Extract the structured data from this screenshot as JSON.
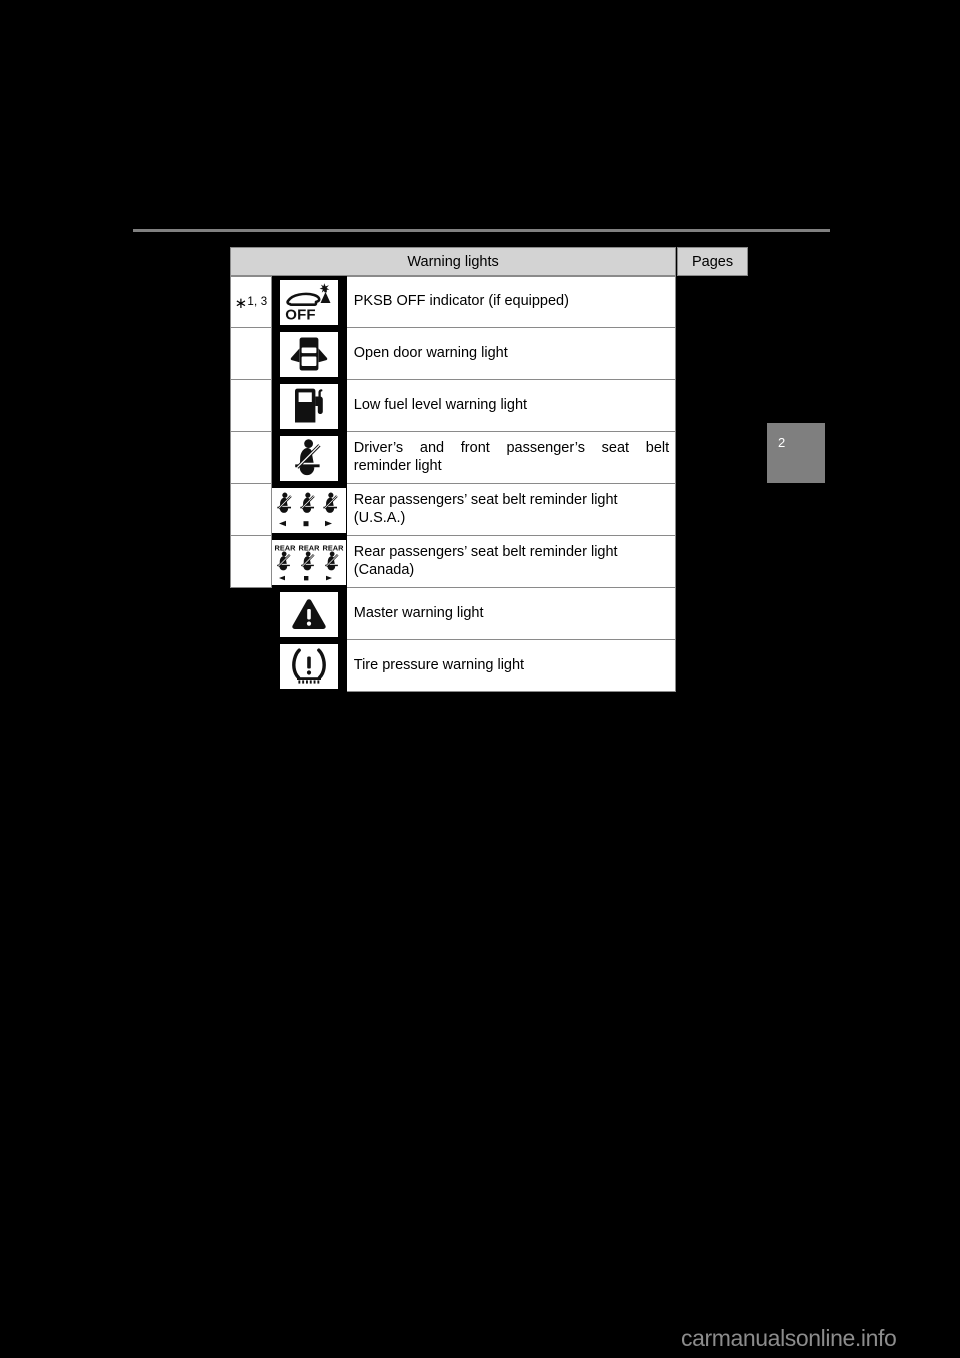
{
  "page": {
    "chapter_tab": "2",
    "watermark": "carmanualsonline.info"
  },
  "table": {
    "header": {
      "main": "Warning lights",
      "pages": "Pages"
    },
    "rows": [
      {
        "note": "∗1, 3",
        "note_star": "∗",
        "note_sup": "1, 3",
        "icon": "pksb-off-indicator-icon",
        "label": "PKSB OFF indicator (if equipped)"
      },
      {
        "note": "",
        "icon": "open-door-warning-icon",
        "label": "Open door warning light"
      },
      {
        "note": "",
        "icon": "low-fuel-level-warning-icon",
        "label": "Low fuel level warning light"
      },
      {
        "note": "",
        "icon": "front-seat-belt-reminder-icon",
        "label_line1": "Driver’s and front passenger’s seat belt",
        "label_line2": "reminder light",
        "label": "Driver’s and front passenger’s seat belt reminder light"
      },
      {
        "note": "",
        "icon": "rear-seat-belt-reminder-usa-icon",
        "label_line1": "Rear passengers’ seat belt reminder light",
        "label_line2": "(U.S.A.)",
        "label": "Rear passengers’ seat belt reminder light (U.S.A.)"
      },
      {
        "note": "",
        "icon": "rear-seat-belt-reminder-canada-icon",
        "label_line1": "Rear passengers’ seat belt reminder light",
        "label_line2": "(Canada)",
        "label": "Rear passengers’ seat belt reminder light (Canada)",
        "icon_sublabels": [
          "REAR",
          "REAR",
          "REAR"
        ]
      },
      {
        "note": "",
        "icon": "master-warning-icon",
        "label": "Master warning light"
      },
      {
        "note": "",
        "icon": "tire-pressure-warning-icon",
        "label": "Tire pressure warning light"
      }
    ]
  },
  "colors": {
    "page_background": "#000000",
    "header_fill": "#d3d3d3",
    "cell_fill": "#ffffff",
    "rule": "#808080",
    "border": "#8a8a8a",
    "tab_fill": "#7f7f7f",
    "watermark": "#8c8c8c"
  }
}
